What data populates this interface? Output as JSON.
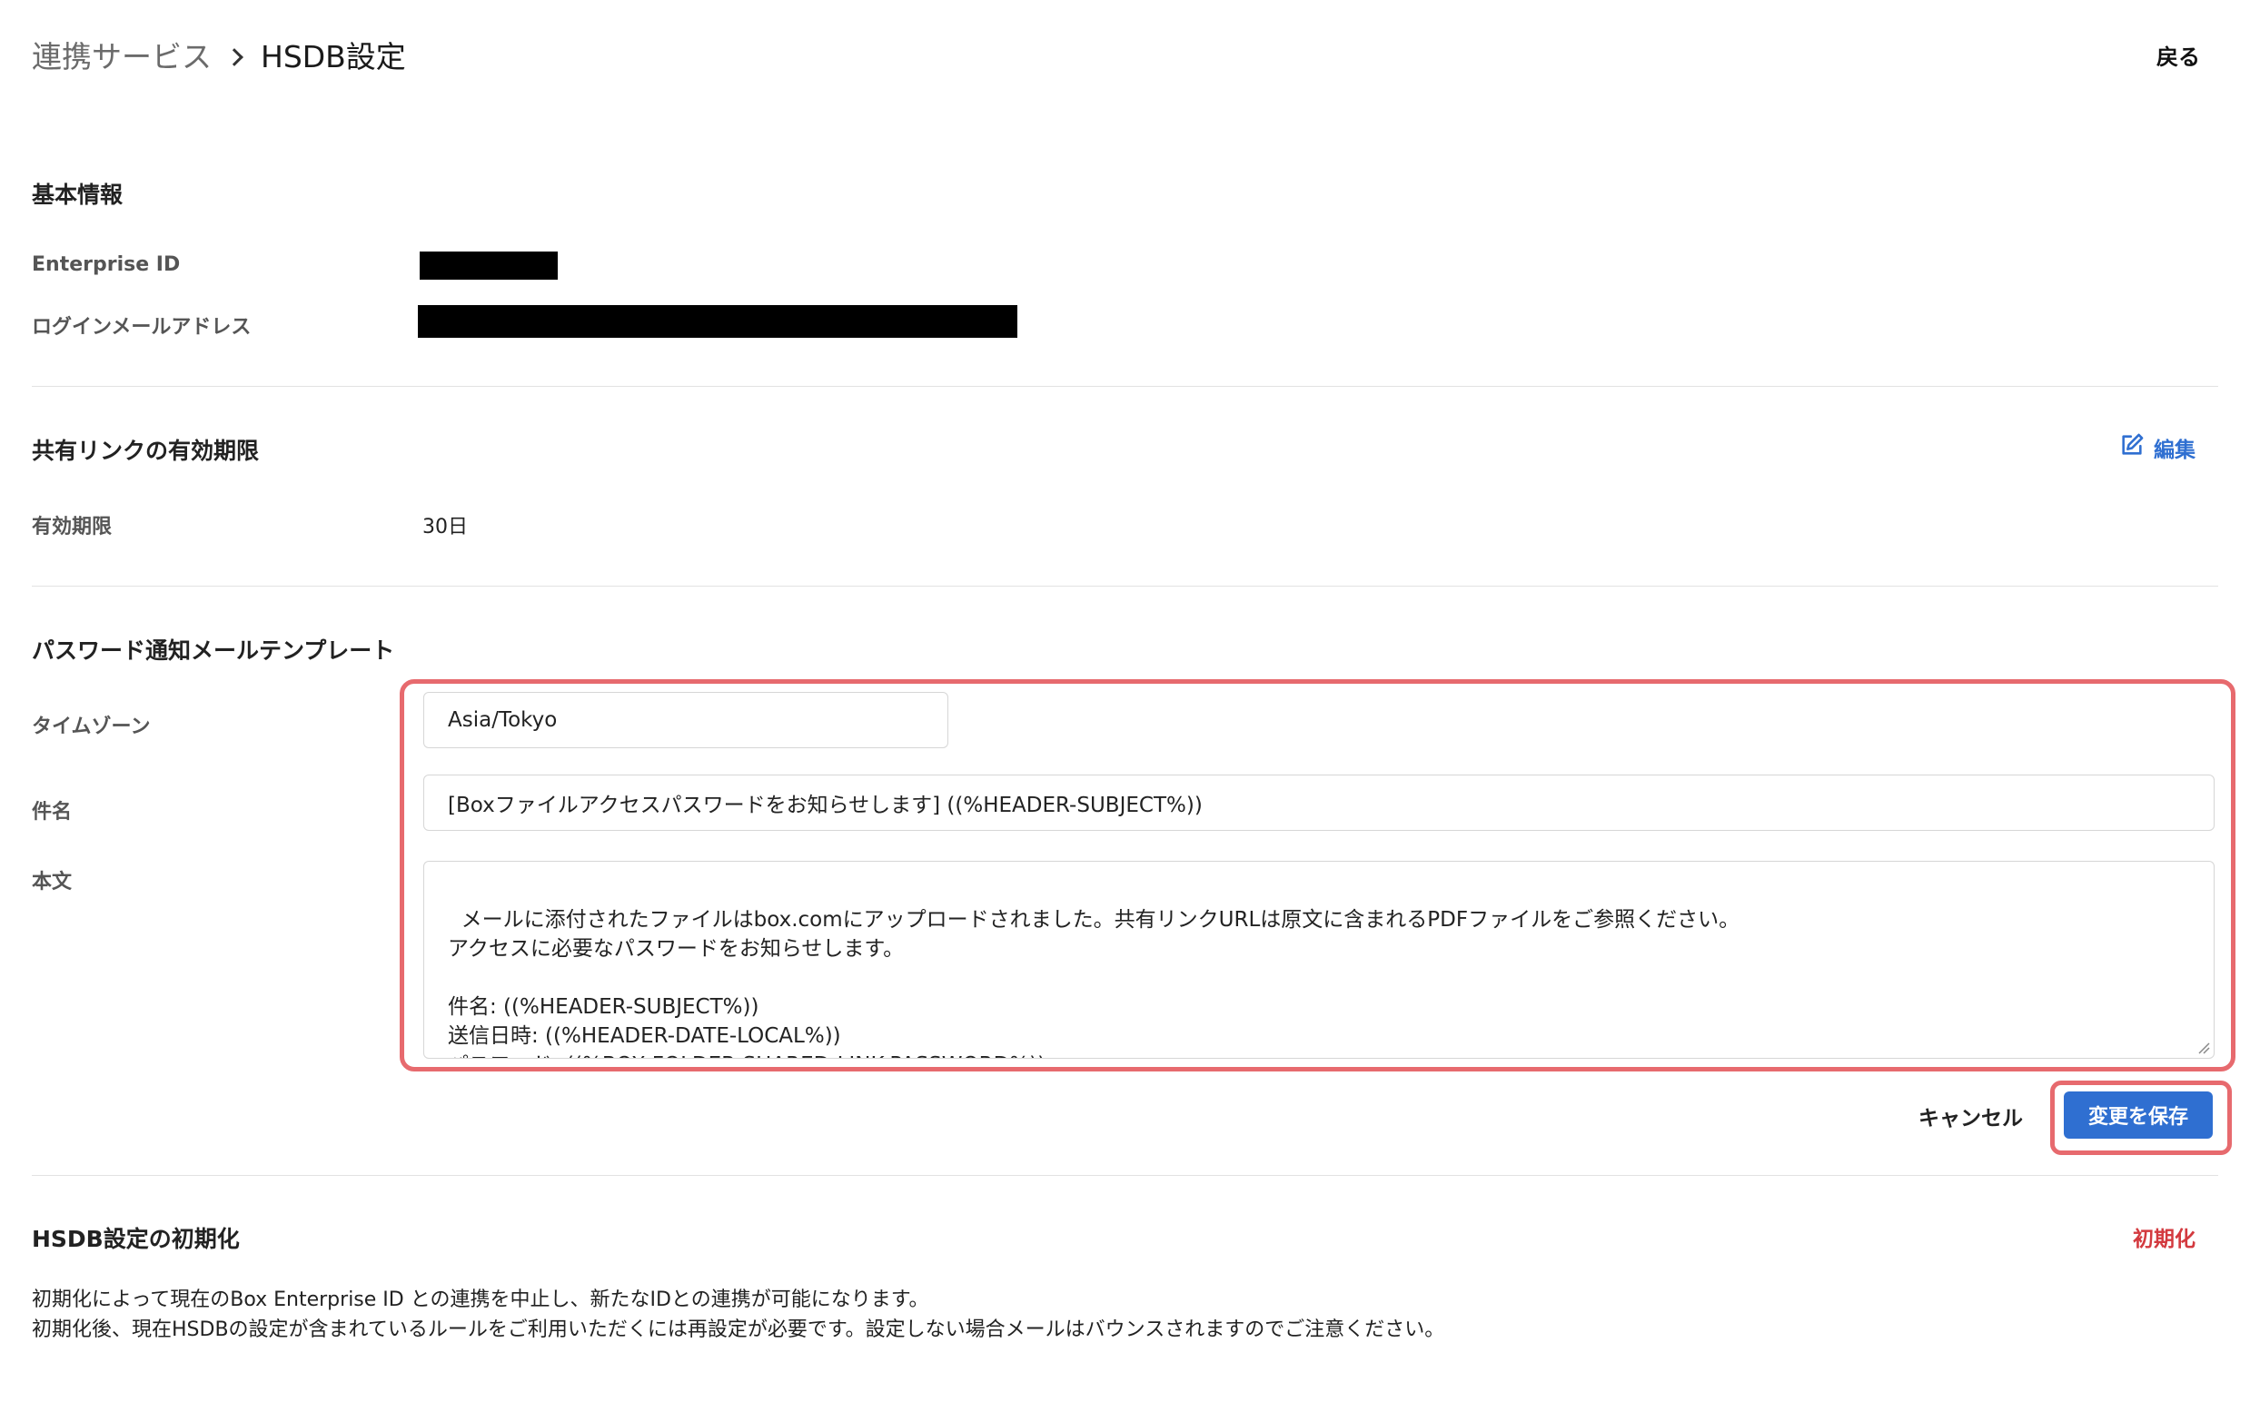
{
  "header": {
    "breadcrumb_parent": "連携サービス",
    "breadcrumb_current": "HSDB設定",
    "back_label": "戻る"
  },
  "basic_info": {
    "title": "基本情報",
    "enterprise_id_label": "Enterprise ID",
    "login_email_label": "ログインメールアドレス"
  },
  "shared_link": {
    "title": "共有リンクの有効期限",
    "edit_label": "編集",
    "expiry_label": "有効期限",
    "expiry_value": "30日"
  },
  "password_template": {
    "title": "パスワード通知メールテンプレート",
    "timezone_label": "タイムゾーン",
    "timezone_value": "Asia/Tokyo",
    "subject_label": "件名",
    "subject_value": "[Boxファイルアクセスパスワードをお知らせします] ((%HEADER-SUBJECT%))",
    "body_label": "本文",
    "body_value": "メールに添付されたファイルはbox.comにアップロードされました。共有リンクURLは原文に含まれるPDFファイルをご参照ください。\nアクセスに必要なパスワードをお知らせします。\n\n件名: ((%HEADER-SUBJECT%))\n送信日時: ((%HEADER-DATE-LOCAL%))\nパスワード: ((%BOX-FOLDER-SHARED-LINK-PASSWORD%))",
    "cancel_label": "キャンセル",
    "save_label": "変更を保存"
  },
  "reset": {
    "title": "HSDB設定の初期化",
    "reset_label": "初期化",
    "description_line1": "初期化によって現在のBox Enterprise ID との連携を中止し、新たなIDとの連携が可能になります。",
    "description_line2": "初期化後、現在HSDBの設定が含まれているルールをご利用いただくには再設定が必要です。設定しない場合メールはバウンスされますのでご注意ください。"
  },
  "colors": {
    "accent": "#2f6fd1",
    "danger": "#d33a3f",
    "highlight": "#e76a6e"
  }
}
